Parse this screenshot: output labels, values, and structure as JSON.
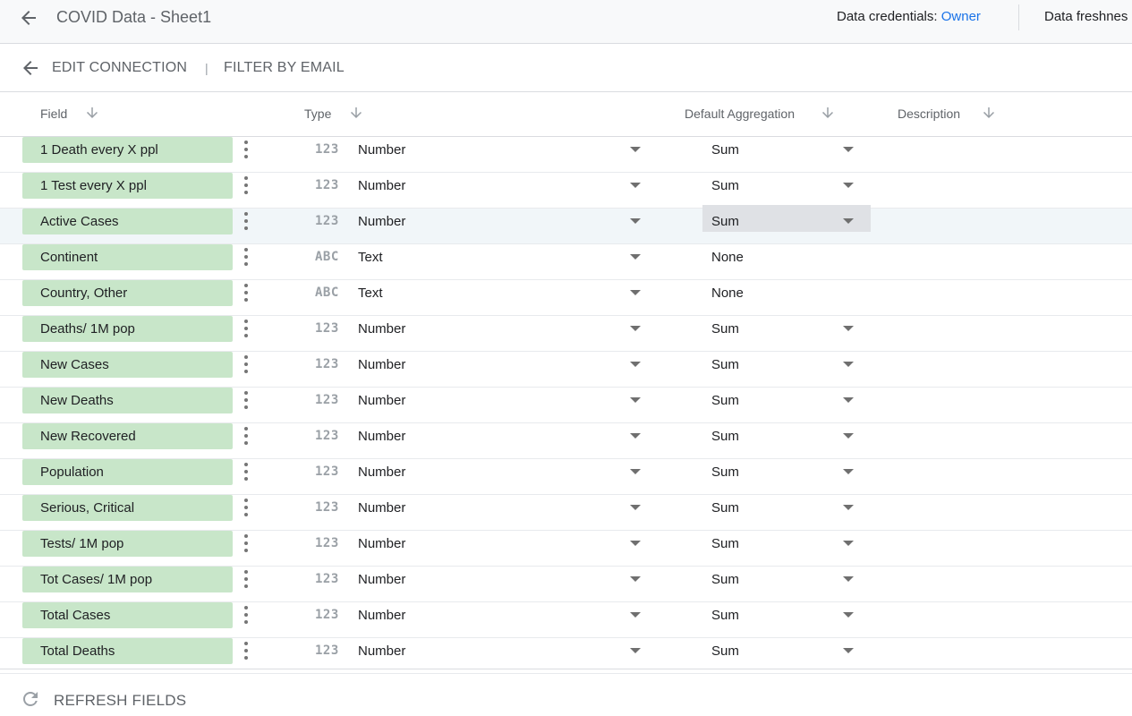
{
  "topbar": {
    "title": "COVID Data - Sheet1",
    "credentials_label": "Data credentials: ",
    "credentials_value": "Owner",
    "freshness_label": "Data freshnes"
  },
  "subbar": {
    "edit_connection": "EDIT CONNECTION",
    "filter_by_email": "FILTER BY EMAIL"
  },
  "columns": {
    "field": "Field",
    "type": "Type",
    "default_aggregation": "Default Aggregation",
    "description": "Description"
  },
  "fields": [
    {
      "name": "1 Death every X ppl",
      "type_icon": "123",
      "type": "Number",
      "aggregation": "Sum"
    },
    {
      "name": "1 Test every X ppl",
      "type_icon": "123",
      "type": "Number",
      "aggregation": "Sum"
    },
    {
      "name": "Active Cases",
      "type_icon": "123",
      "type": "Number",
      "aggregation": "Sum"
    },
    {
      "name": "Continent",
      "type_icon": "ABC",
      "type": "Text",
      "aggregation": "None"
    },
    {
      "name": "Country, Other",
      "type_icon": "ABC",
      "type": "Text",
      "aggregation": "None"
    },
    {
      "name": "Deaths/ 1M pop",
      "type_icon": "123",
      "type": "Number",
      "aggregation": "Sum"
    },
    {
      "name": "New Cases",
      "type_icon": "123",
      "type": "Number",
      "aggregation": "Sum"
    },
    {
      "name": "New Deaths",
      "type_icon": "123",
      "type": "Number",
      "aggregation": "Sum"
    },
    {
      "name": "New Recovered",
      "type_icon": "123",
      "type": "Number",
      "aggregation": "Sum"
    },
    {
      "name": "Population",
      "type_icon": "123",
      "type": "Number",
      "aggregation": "Sum"
    },
    {
      "name": "Serious, Critical",
      "type_icon": "123",
      "type": "Number",
      "aggregation": "Sum"
    },
    {
      "name": "Tests/ 1M pop",
      "type_icon": "123",
      "type": "Number",
      "aggregation": "Sum"
    },
    {
      "name": "Tot Cases/ 1M pop",
      "type_icon": "123",
      "type": "Number",
      "aggregation": "Sum"
    },
    {
      "name": "Total Cases",
      "type_icon": "123",
      "type": "Number",
      "aggregation": "Sum"
    },
    {
      "name": "Total Deaths",
      "type_icon": "123",
      "type": "Number",
      "aggregation": "Sum"
    }
  ],
  "highlighted_row": 2,
  "footer": {
    "refresh_fields": "REFRESH FIELDS"
  },
  "colors": {
    "accent": "#1a73e8",
    "field_chip": "#c8e6c9",
    "row_highlight": "#f1f6f9"
  }
}
